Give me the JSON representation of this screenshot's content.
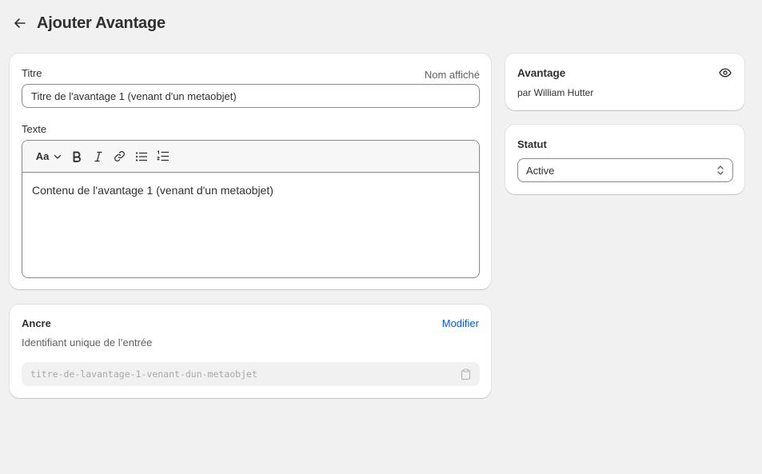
{
  "header": {
    "title": "Ajouter Avantage"
  },
  "main": {
    "title_label": "Titre",
    "title_hint": "Nom affiché",
    "title_value": "Titre de l'avantage 1 (venant d'un metaobjet)",
    "text_label": "Texte",
    "toolbar": {
      "font_label": "Aa"
    },
    "text_value": "Contenu de l'avantage 1 (venant d'un metaobjet)"
  },
  "anchor": {
    "title": "Ancre",
    "edit_label": "Modifier",
    "description": "Identifiant unique de l’entrée",
    "handle_value": "titre-de-lavantage-1-venant-dun-metaobjet"
  },
  "avantage": {
    "title": "Avantage",
    "author": "par William Hutter"
  },
  "statut": {
    "title": "Statut",
    "selected": "Active"
  },
  "icons": [
    "arrow-left-icon",
    "font-icon",
    "chevron-down-icon",
    "bold-icon",
    "italic-icon",
    "link-icon",
    "bullet-list-icon",
    "numbered-list-icon",
    "clipboard-icon",
    "eye-icon",
    "select-chevrons-icon"
  ],
  "colors": {
    "background": "#f1f1f1",
    "card": "#ffffff",
    "link": "#005bd3",
    "text": "#303030",
    "muted": "#616161"
  }
}
